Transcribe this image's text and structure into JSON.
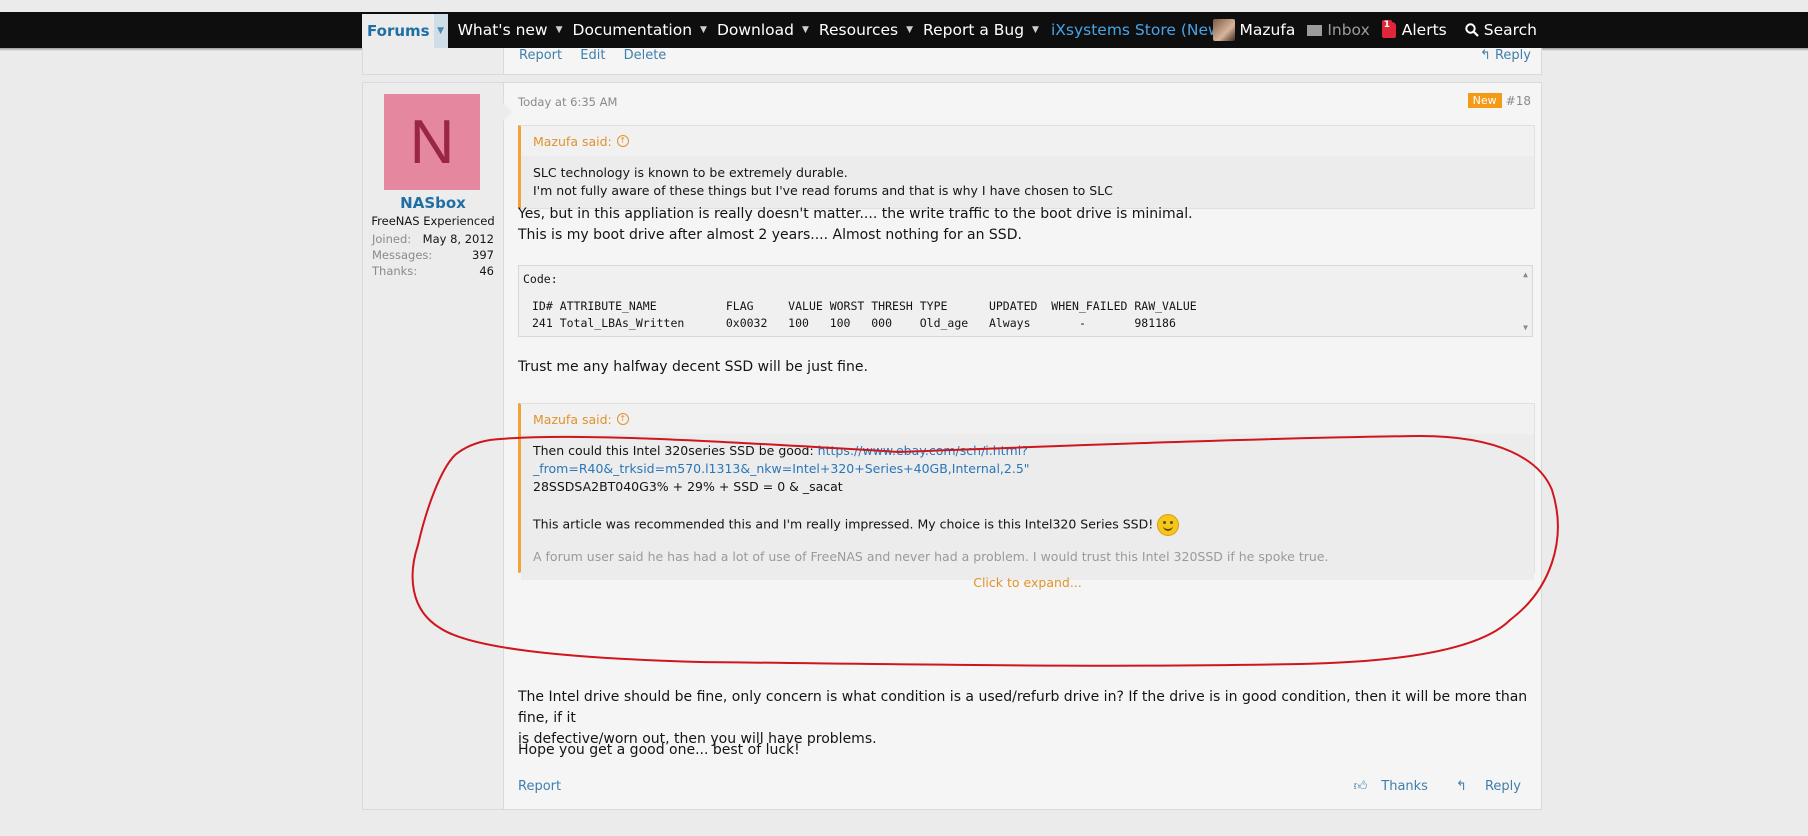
{
  "nav": {
    "forums": "Forums",
    "items": [
      "What's new",
      "Documentation",
      "Download",
      "Resources",
      "Report a Bug"
    ],
    "store": "iXsystems Store (New!)",
    "user": "Mazufa",
    "inbox": "Inbox",
    "alerts": "Alerts",
    "alerts_count": "1",
    "search": "Search"
  },
  "prev_post": {
    "actions": [
      "Report",
      "Edit",
      "Delete"
    ],
    "reply": "Reply"
  },
  "post": {
    "avatar_letter": "N",
    "username": "NASbox",
    "user_title": "FreeNAS Experienced",
    "stats": [
      {
        "label": "Joined:",
        "value": "May 8, 2012"
      },
      {
        "label": "Messages:",
        "value": "397"
      },
      {
        "label": "Thanks:",
        "value": "46"
      }
    ],
    "date": "Today at 6:35 AM",
    "badge": "New",
    "number": "#18",
    "quote1": {
      "author": "Mazufa said:",
      "line1": "SLC technology is known to be extremely durable.",
      "line2": "I'm not fully aware of these things but I've read forums and that is why I have chosen to SLC"
    },
    "para1_line1": "Yes, but in this appliation is really doesn't matter.... the write traffic to the boot drive is minimal.",
    "para1_line2": "This is my boot drive after almost 2 years.... Almost nothing for an SSD.",
    "code": {
      "header": "Code:",
      "line1": "ID# ATTRIBUTE_NAME          FLAG     VALUE WORST THRESH TYPE      UPDATED  WHEN_FAILED RAW_VALUE",
      "line2": "241 Total_LBAs_Written      0x0032   100   100   000    Old_age   Always       -       981186"
    },
    "para2": "Trust me any halfway decent SSD will be just fine.",
    "quote2": {
      "author": "Mazufa said:",
      "line1_text": "Then could this Intel 320series SSD be good: ",
      "line1_link": "https://www.ebay.com/sch/i.html?_from=R40&_trksid=m570.l1313&_nkw=Intel+320+Series+40GB,Internal,2.5\"",
      "line2": "28SSDSA2BT040G3% + 29% + SSD = 0 & _sacat",
      "line3": "This article was recommended this and I'm really impressed. My choice is this Intel320 Series SSD!",
      "line4": "A forum user said he has had a lot of use of FreeNAS and never had a problem. I would trust this Intel 320SSD if he spoke true.",
      "expand": "Click to expand..."
    },
    "para3_line1": "The Intel drive should be fine, only concern is what condition is a used/refurb drive in? If the drive is in good condition, then it will be more than fine, if it",
    "para3_line2": "is defective/worn out, then you will have problems.",
    "para4": "Hope you get a good one... best of luck!",
    "footer": {
      "report": "Report",
      "thanks": "Thanks",
      "reply": "Reply"
    }
  },
  "colors": {
    "navbar": "#0e0e0e",
    "link": "#1f6fa3",
    "quote_accent": "#f0a33b",
    "annotation": "#d0161d",
    "avatar_bg": "#e5889f"
  }
}
